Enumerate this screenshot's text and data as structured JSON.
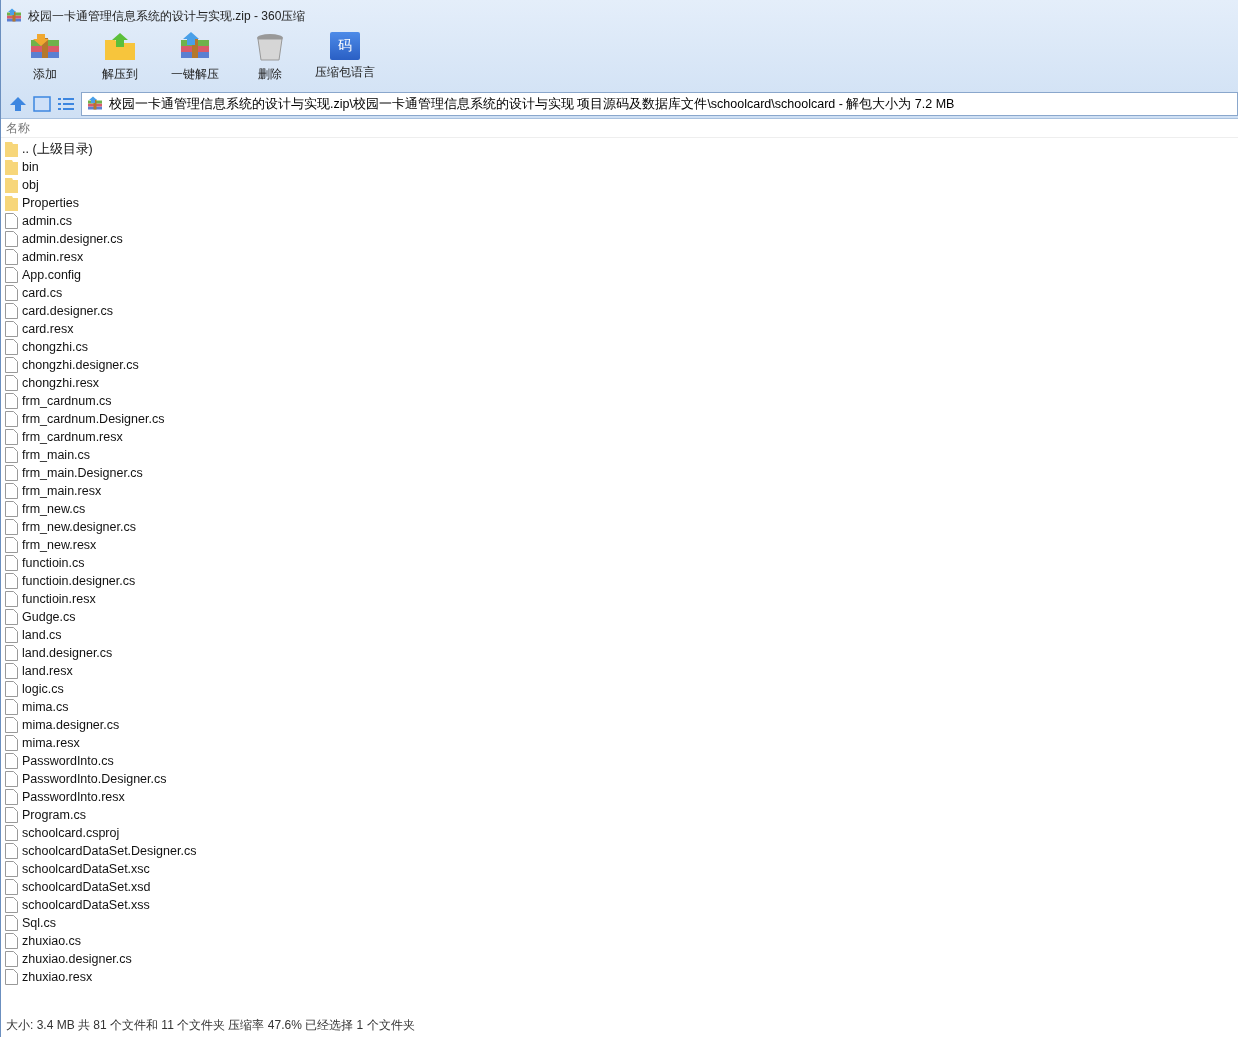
{
  "window": {
    "title": "校园一卡通管理信息系统的设计与实现.zip - 360压缩"
  },
  "toolbar": [
    {
      "label": "添加",
      "kind": "add"
    },
    {
      "label": "解压到",
      "kind": "extract"
    },
    {
      "label": "一键解压",
      "kind": "quick"
    },
    {
      "label": "删除",
      "kind": "delete"
    },
    {
      "label": "压缩包语言",
      "kind": "language",
      "glyph": "码"
    }
  ],
  "address_bar": {
    "path": "校园一卡通管理信息系统的设计与实现.zip\\校园一卡通管理信息系统的设计与实现 项目源码及数据库文件\\schoolcard\\schoolcard - 解包大小为 7.2 MB"
  },
  "table": {
    "columns": [
      "名称"
    ],
    "rows": [
      {
        "name": ".. (上级目录)",
        "kind": "folder"
      },
      {
        "name": "bin",
        "kind": "folder"
      },
      {
        "name": "obj",
        "kind": "folder"
      },
      {
        "name": "Properties",
        "kind": "folder"
      },
      {
        "name": "admin.cs",
        "kind": "file"
      },
      {
        "name": "admin.designer.cs",
        "kind": "file"
      },
      {
        "name": "admin.resx",
        "kind": "file"
      },
      {
        "name": "App.config",
        "kind": "file"
      },
      {
        "name": "card.cs",
        "kind": "file"
      },
      {
        "name": "card.designer.cs",
        "kind": "file"
      },
      {
        "name": "card.resx",
        "kind": "file"
      },
      {
        "name": "chongzhi.cs",
        "kind": "file"
      },
      {
        "name": "chongzhi.designer.cs",
        "kind": "file"
      },
      {
        "name": "chongzhi.resx",
        "kind": "file"
      },
      {
        "name": "frm_cardnum.cs",
        "kind": "file"
      },
      {
        "name": "frm_cardnum.Designer.cs",
        "kind": "file"
      },
      {
        "name": "frm_cardnum.resx",
        "kind": "file"
      },
      {
        "name": "frm_main.cs",
        "kind": "file"
      },
      {
        "name": "frm_main.Designer.cs",
        "kind": "file"
      },
      {
        "name": "frm_main.resx",
        "kind": "file"
      },
      {
        "name": "frm_new.cs",
        "kind": "file"
      },
      {
        "name": "frm_new.designer.cs",
        "kind": "file"
      },
      {
        "name": "frm_new.resx",
        "kind": "file"
      },
      {
        "name": "functioin.cs",
        "kind": "file"
      },
      {
        "name": "functioin.designer.cs",
        "kind": "file"
      },
      {
        "name": "functioin.resx",
        "kind": "file"
      },
      {
        "name": "Gudge.cs",
        "kind": "file"
      },
      {
        "name": "land.cs",
        "kind": "file"
      },
      {
        "name": "land.designer.cs",
        "kind": "file"
      },
      {
        "name": "land.resx",
        "kind": "file"
      },
      {
        "name": "logic.cs",
        "kind": "file"
      },
      {
        "name": "mima.cs",
        "kind": "file"
      },
      {
        "name": "mima.designer.cs",
        "kind": "file"
      },
      {
        "name": "mima.resx",
        "kind": "file"
      },
      {
        "name": "PasswordInto.cs",
        "kind": "file"
      },
      {
        "name": "PasswordInto.Designer.cs",
        "kind": "file"
      },
      {
        "name": "PasswordInto.resx",
        "kind": "file"
      },
      {
        "name": "Program.cs",
        "kind": "file"
      },
      {
        "name": "schoolcard.csproj",
        "kind": "file"
      },
      {
        "name": "schoolcardDataSet.Designer.cs",
        "kind": "file"
      },
      {
        "name": "schoolcardDataSet.xsc",
        "kind": "file"
      },
      {
        "name": "schoolcardDataSet.xsd",
        "kind": "file"
      },
      {
        "name": "schoolcardDataSet.xss",
        "kind": "file"
      },
      {
        "name": "Sql.cs",
        "kind": "file"
      },
      {
        "name": "zhuxiao.cs",
        "kind": "file"
      },
      {
        "name": "zhuxiao.designer.cs",
        "kind": "file"
      },
      {
        "name": "zhuxiao.resx",
        "kind": "file"
      }
    ]
  },
  "status_bar": "大小: 3.4 MB 共 81 个文件和 11 个文件夹 压缩率 47.6% 已经选择 1 个文件夹"
}
